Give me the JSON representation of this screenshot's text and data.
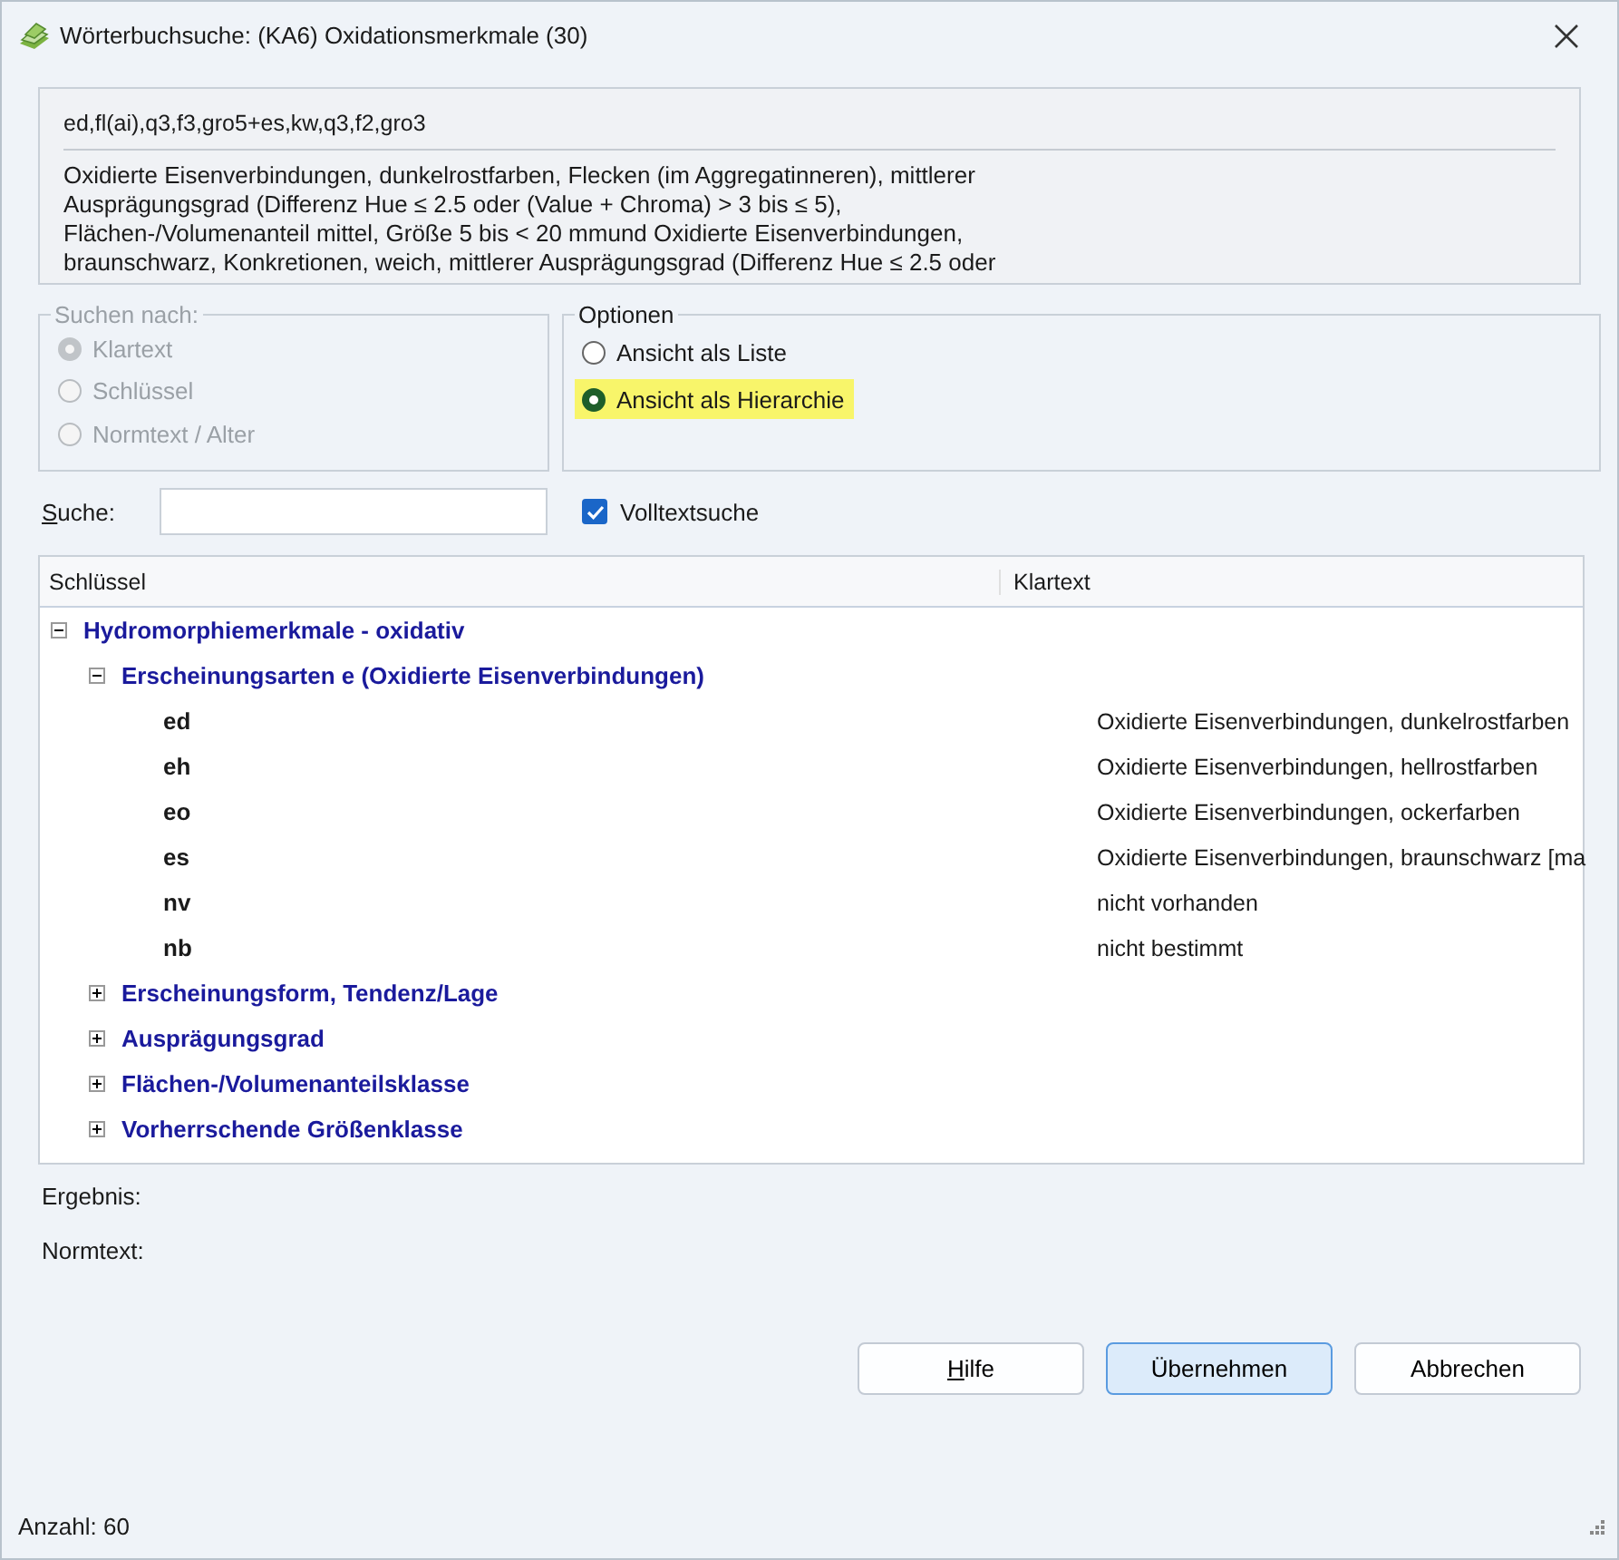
{
  "window": {
    "title": "Wörterbuchsuche: (KA6) Oxidationsmerkmale (30)"
  },
  "code": "ed,fl(ai),q3,f3,gro5+es,kw,q3,f2,gro3",
  "description": [
    "Oxidierte Eisenverbindungen, dunkelrostfarben, Flecken (im Aggregatinneren), mittlerer",
    "Ausprägungsgrad (Differenz Hue ≤ 2.5 oder (Value + Chroma) > 3 bis ≤ 5),",
    "Flächen-/Volumenanteil mittel, Größe 5 bis < 20 mmund Oxidierte Eisenverbindungen,",
    "braunschwarz, Konkretionen, weich, mittlerer Ausprägungsgrad (Differenz Hue ≤ 2.5 oder"
  ],
  "search_by": {
    "title": "Suchen nach:",
    "disabled": true,
    "options": [
      {
        "label": "Klartext",
        "selected": true
      },
      {
        "label": "Schlüssel",
        "selected": false
      },
      {
        "label": "Normtext / Alter",
        "selected": false
      }
    ]
  },
  "view_options": {
    "title": "Optionen",
    "options": [
      {
        "label": "Ansicht als Liste",
        "selected": false,
        "highlighted": false
      },
      {
        "label": "Ansicht als Hierarchie",
        "selected": true,
        "highlighted": true
      }
    ]
  },
  "search": {
    "label": "Suche:"
  },
  "fulltext": {
    "label": "Volltextsuche",
    "checked": true
  },
  "tree": {
    "columns": [
      "Schlüssel",
      "Klartext"
    ],
    "items": [
      {
        "key": "Hydromorphiemerkmale - oxidativ",
        "expanded": true,
        "children": [
          {
            "key": "Erscheinungsarten e (Oxidierte Eisenverbindungen)",
            "expanded": true,
            "children": [
              {
                "key": "ed",
                "text": "Oxidierte Eisenverbindungen, dunkelrostfarben"
              },
              {
                "key": "eh",
                "text": "Oxidierte Eisenverbindungen, hellrostfarben"
              },
              {
                "key": "eo",
                "text": "Oxidierte Eisenverbindungen, ockerfarben"
              },
              {
                "key": "es",
                "text": "Oxidierte Eisenverbindungen, braunschwarz [ma"
              },
              {
                "key": "nv",
                "text": "nicht vorhanden"
              },
              {
                "key": "nb",
                "text": "nicht bestimmt"
              }
            ]
          },
          {
            "key": "Erscheinungsform, Tendenz/Lage",
            "expanded": false
          },
          {
            "key": "Ausprägungsgrad",
            "expanded": false
          },
          {
            "key": "Flächen-/Volumenanteilsklasse",
            "expanded": false
          },
          {
            "key": "Vorherrschende Größenklasse",
            "expanded": false
          }
        ]
      }
    ]
  },
  "result_label": "Ergebnis:",
  "normtext_label": "Normtext:",
  "buttons": [
    {
      "label": "Hilfe",
      "default": false
    },
    {
      "label": "Übernehmen",
      "default": true
    },
    {
      "label": "Abbrechen",
      "default": false
    }
  ],
  "status_bar": {
    "count": "Anzahl: 60"
  }
}
